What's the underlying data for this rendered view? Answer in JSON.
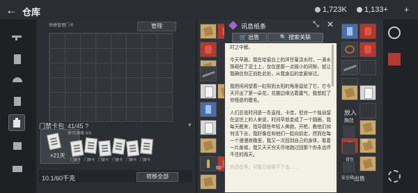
{
  "header": {
    "title": "仓库",
    "currencies": [
      {
        "value": "1,723K",
        "color": "#bfc4c9"
      },
      {
        "value": "1,133+",
        "color": "#c9c9c9"
      }
    ]
  },
  "storage_panel": {
    "card_label": "快捷管理门卡",
    "manage_label": "管理",
    "capacity_label": "门禁卡包: 41/45 ?",
    "item_caption": "养司满格 9/9",
    "card_count": "×21天",
    "key_labels": [
      "门禁卡",
      "门禁卡",
      "门禁卡",
      "门禁卡",
      "门禁卡",
      "门禁卡"
    ],
    "bottom_count": "10.1/60千克",
    "transfer_label": "转移全部"
  },
  "popup": {
    "title": "讯息纸条",
    "sell_label": "出售",
    "search_label": "搜索关联",
    "paragraphs": [
      "时之中醒。",
      "今天早晨，我在给窗台上的洋甘菊浇水时，一滴水珠砸在了泥土上，仅仅是那一点微小的间隙，就让我确信你正前赴此处，从我身后的走廊穿过。",
      "我把闲闲望着一缸照到太阳的角落留给了它，它今天开出了第一朵花，花瓣边缘沾着露气，我想起了你怪是的睫毛。",
      "人们总说时间是一条直线，卡佳，但对一个独自留在这世上的人来说，时间早就变成了一个圆圈，我每天醒来，指导那些年轻人奔跑，开枪，教他们如何活下去，我好像在和他们一起向前走，然而在每一个漫漫夜晚里，我又一次回到自己的身体，看着一片废墟，我又天天穷天尽地跑过回那个你永远停不住的雨天。"
    ],
    "faded_line": "你还在等，可我已经等不下去……"
  },
  "right_panel": {
    "put_in": "放入",
    "counts": [
      "60",
      "60"
    ],
    "ring_label": "胸挂",
    "backpack_label": "背包",
    "safe_label": "安全箱",
    "sale_label": "出售"
  }
}
